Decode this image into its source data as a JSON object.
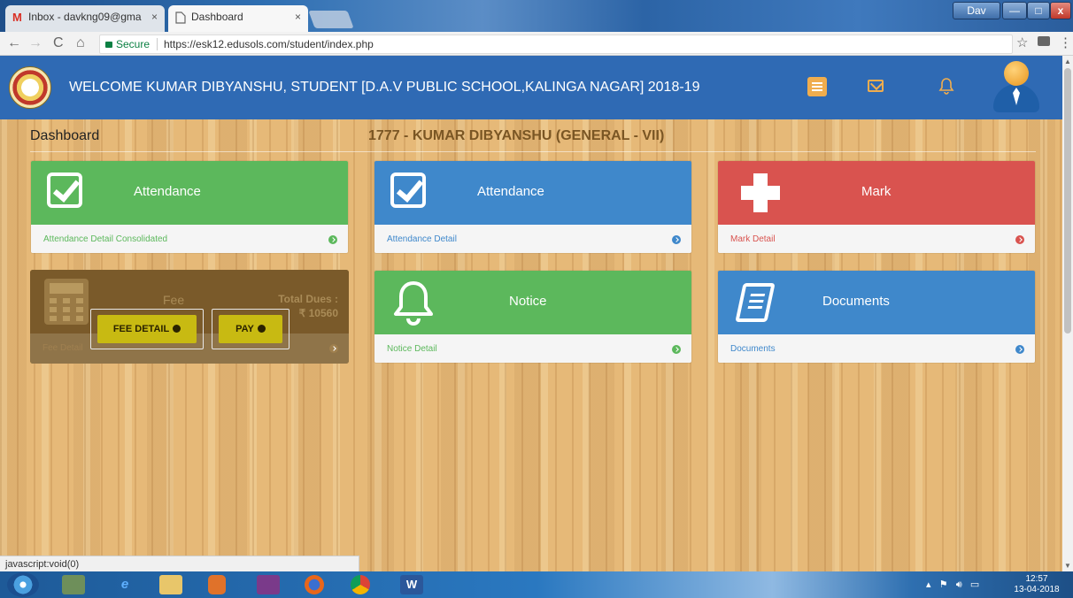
{
  "browser": {
    "tabs": [
      {
        "title": "Inbox - davkng09@gma",
        "icon": "gmail-icon",
        "active": false
      },
      {
        "title": "Dashboard",
        "icon": "page-icon",
        "active": true
      }
    ],
    "close_glyph": "×",
    "window_user": "Dav",
    "window_controls": {
      "minimize": "—",
      "maximize": "□",
      "close": "x"
    },
    "nav": {
      "back": "←",
      "forward": "→",
      "reload": "C",
      "home": "⌂"
    },
    "secure_label": "Secure",
    "url": "https://esk12.edusols.com/student/index.php",
    "star": "☆",
    "menu": "⋮"
  },
  "header": {
    "welcome": "WELCOME KUMAR  DIBYANSHU, STUDENT [D.A.V PUBLIC SCHOOL,KALINGA NAGAR] 2018-19",
    "bell_glyph": "🔔︎"
  },
  "page": {
    "title": "Dashboard",
    "student": "1777 - KUMAR DIBYANSHU (GENERAL - VII)"
  },
  "cards": {
    "attendance_consolidated": {
      "title": "Attendance",
      "link": "Attendance Detail Consolidated"
    },
    "attendance": {
      "title": "Attendance",
      "link": "Attendance Detail"
    },
    "mark": {
      "title": "Mark",
      "link": "Mark Detail"
    },
    "fee": {
      "title": "Fee",
      "dues_label": "Total Dues :",
      "dues_amount": "₹ 10560",
      "link": "Fee Detail",
      "fee_detail_button": "FEE DETAIL",
      "pay_button": "PAY"
    },
    "notice": {
      "title": "Notice",
      "link": "Notice Detail"
    },
    "documents": {
      "title": "Documents",
      "link": "Documents"
    }
  },
  "statusbar": {
    "text": "javascript:void(0)"
  },
  "taskbar": {
    "word_label": "W",
    "time": "12:57",
    "date": "13-04-2018"
  },
  "colors": {
    "nav_blue": "#2f6ab4",
    "green": "#5cb85c",
    "blue": "#3f88cb",
    "red": "#d9534f",
    "accent_orange": "#f0ad4e",
    "action_yellow": "#c8ba12"
  }
}
